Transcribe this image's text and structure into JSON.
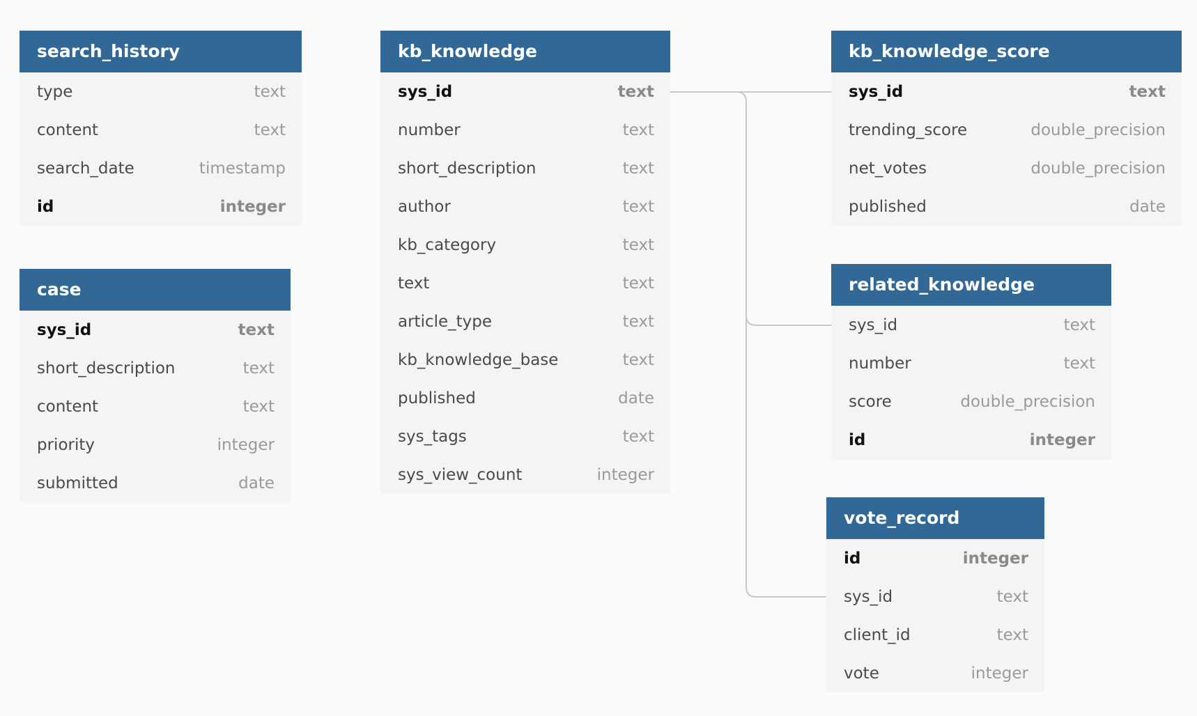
{
  "tables": {
    "search_history": {
      "name": "search_history",
      "columns": [
        {
          "name": "type",
          "type": "text",
          "pk": false
        },
        {
          "name": "content",
          "type": "text",
          "pk": false
        },
        {
          "name": "search_date",
          "type": "timestamp",
          "pk": false
        },
        {
          "name": "id",
          "type": "integer",
          "pk": true
        }
      ]
    },
    "case": {
      "name": "case",
      "columns": [
        {
          "name": "sys_id",
          "type": "text",
          "pk": true
        },
        {
          "name": "short_description",
          "type": "text",
          "pk": false
        },
        {
          "name": "content",
          "type": "text",
          "pk": false
        },
        {
          "name": "priority",
          "type": "integer",
          "pk": false
        },
        {
          "name": "submitted",
          "type": "date",
          "pk": false
        }
      ]
    },
    "kb_knowledge": {
      "name": "kb_knowledge",
      "columns": [
        {
          "name": "sys_id",
          "type": "text",
          "pk": true
        },
        {
          "name": "number",
          "type": "text",
          "pk": false
        },
        {
          "name": "short_description",
          "type": "text",
          "pk": false
        },
        {
          "name": "author",
          "type": "text",
          "pk": false
        },
        {
          "name": "kb_category",
          "type": "text",
          "pk": false
        },
        {
          "name": "text",
          "type": "text",
          "pk": false
        },
        {
          "name": "article_type",
          "type": "text",
          "pk": false
        },
        {
          "name": "kb_knowledge_base",
          "type": "text",
          "pk": false
        },
        {
          "name": "published",
          "type": "date",
          "pk": false
        },
        {
          "name": "sys_tags",
          "type": "text",
          "pk": false
        },
        {
          "name": "sys_view_count",
          "type": "integer",
          "pk": false
        }
      ]
    },
    "kb_knowledge_score": {
      "name": "kb_knowledge_score",
      "columns": [
        {
          "name": "sys_id",
          "type": "text",
          "pk": true
        },
        {
          "name": "trending_score",
          "type": "double_precision",
          "pk": false
        },
        {
          "name": "net_votes",
          "type": "double_precision",
          "pk": false
        },
        {
          "name": "published",
          "type": "date",
          "pk": false
        }
      ]
    },
    "related_knowledge": {
      "name": "related_knowledge",
      "columns": [
        {
          "name": "sys_id",
          "type": "text",
          "pk": false
        },
        {
          "name": "number",
          "type": "text",
          "pk": false
        },
        {
          "name": "score",
          "type": "double_precision",
          "pk": false
        },
        {
          "name": "id",
          "type": "integer",
          "pk": true
        }
      ]
    },
    "vote_record": {
      "name": "vote_record",
      "columns": [
        {
          "name": "id",
          "type": "integer",
          "pk": true
        },
        {
          "name": "sys_id",
          "type": "text",
          "pk": false
        },
        {
          "name": "client_id",
          "type": "text",
          "pk": false
        },
        {
          "name": "vote",
          "type": "integer",
          "pk": false
        }
      ]
    }
  },
  "relationships": [
    {
      "from": "kb_knowledge.sys_id",
      "to": "kb_knowledge_score.sys_id"
    },
    {
      "from": "kb_knowledge.sys_id",
      "to": "related_knowledge.sys_id"
    },
    {
      "from": "kb_knowledge.sys_id",
      "to": "vote_record.sys_id"
    }
  ],
  "colors": {
    "header_bg": "#316896",
    "header_text": "#ffffff",
    "body_bg": "#f4f4f4",
    "connector": "#c8c8c8"
  }
}
